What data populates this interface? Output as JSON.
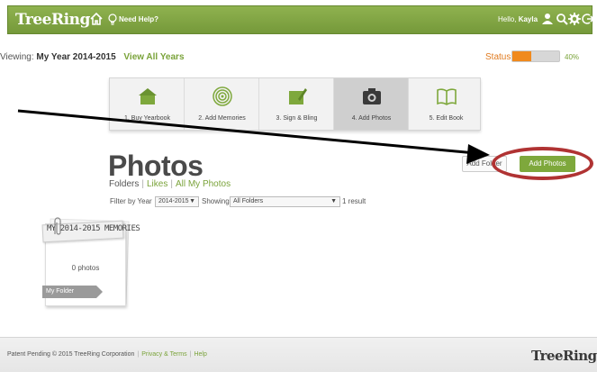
{
  "header": {
    "logo": "TreeRing",
    "need_help": "Need Help?",
    "greeting_prefix": "Hello,",
    "user_name": "Kayla",
    "icons": [
      "home-icon",
      "help-bulb-icon",
      "user-icon",
      "search-icon",
      "gear-icon",
      "logout-icon"
    ]
  },
  "viewing": {
    "prefix": "Viewing:",
    "year_label": "My Year 2014-2015",
    "view_all": "View All Years"
  },
  "status": {
    "label": "Status:",
    "percent": 40,
    "percent_text": "40%",
    "fill_color": "#f08a1e"
  },
  "steps": [
    {
      "label": "1. Buy Yearbook",
      "icon": "house-card-icon",
      "active": false
    },
    {
      "label": "2. Add Memories",
      "icon": "target-rings-icon",
      "active": false
    },
    {
      "label": "3. Sign & Bling",
      "icon": "pencil-card-icon",
      "active": false
    },
    {
      "label": "4. Add Photos",
      "icon": "camera-icon",
      "active": true
    },
    {
      "label": "5. Edit Book",
      "icon": "open-book-icon",
      "active": false
    }
  ],
  "page": {
    "title": "Photos",
    "tabs": {
      "folders": "Folders",
      "likes": "Likes",
      "all": "All My Photos",
      "separator": "|"
    },
    "filter": {
      "year_label": "Filter by Year",
      "year_value": "2014-2015",
      "showing_label": "Showing",
      "showing_value": "All Folders",
      "result_count": "1 result"
    },
    "buttons": {
      "add_folder": "Add Folder",
      "add_photos": "Add Photos"
    }
  },
  "folder": {
    "title": "MY 2014-2015 MEMORIES",
    "count": "0 photos",
    "tag": "My Folder"
  },
  "footer": {
    "copyright": "Patent Pending © 2015 TreeRing Corporation",
    "privacy": "Privacy & Terms",
    "help": "Help",
    "separator": "|",
    "logo": "TreeRing"
  },
  "colors": {
    "brand_green": "#7ea83c",
    "highlight_red": "#b03333",
    "accent_orange": "#f08a1e"
  }
}
